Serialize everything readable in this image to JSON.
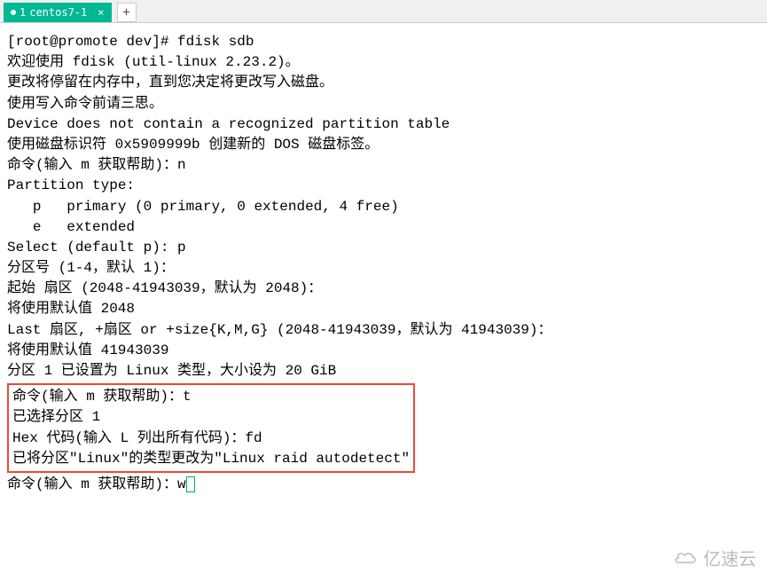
{
  "tabbar": {
    "tab_number": "1",
    "tab_label": "centos7-1",
    "close_glyph": "×",
    "newtab_glyph": "+"
  },
  "terminal": {
    "prompt_line": "[root@promote dev]# fdisk sdb",
    "welcome": "欢迎使用 fdisk (util-linux 2.23.2)。",
    "blank1": "",
    "note1": "更改将停留在内存中，直到您决定将更改写入磁盘。",
    "note2": "使用写入命令前请三思。",
    "blank2": "",
    "warn1": "Device does not contain a recognized partition table",
    "warn2": "使用磁盘标识符 0x5909999b 创建新的 DOS 磁盘标签。",
    "blank3": "",
    "cmd_n": "命令(输入 m 获取帮助)：n",
    "ptype_header": "Partition type:",
    "ptype_p": "   p   primary (0 primary, 0 extended, 4 free)",
    "ptype_e": "   e   extended",
    "select_p": "Select (default p): p",
    "part_num": "分区号 (1-4，默认 1)：",
    "start_sector": "起始 扇区 (2048-41943039，默认为 2048)：",
    "default_2048": "将使用默认值 2048",
    "last_sector": "Last 扇区, +扇区 or +size{K,M,G} (2048-41943039，默认为 41943039)：",
    "default_last": "将使用默认值 41943039",
    "part_set": "分区 1 已设置为 Linux 类型，大小设为 20 GiB",
    "blank4": "",
    "box_cmd_t": "命令(输入 m 获取帮助)：t",
    "box_selected": "已选择分区 1",
    "box_hex": "Hex 代码(输入 L 列出所有代码)：fd",
    "box_changed": "已将分区\"Linux\"的类型更改为\"Linux raid autodetect\"",
    "blank5": "",
    "cmd_w_prefix": "命令(输入 m 获取帮助)：w"
  },
  "watermark": {
    "text": "亿速云"
  }
}
